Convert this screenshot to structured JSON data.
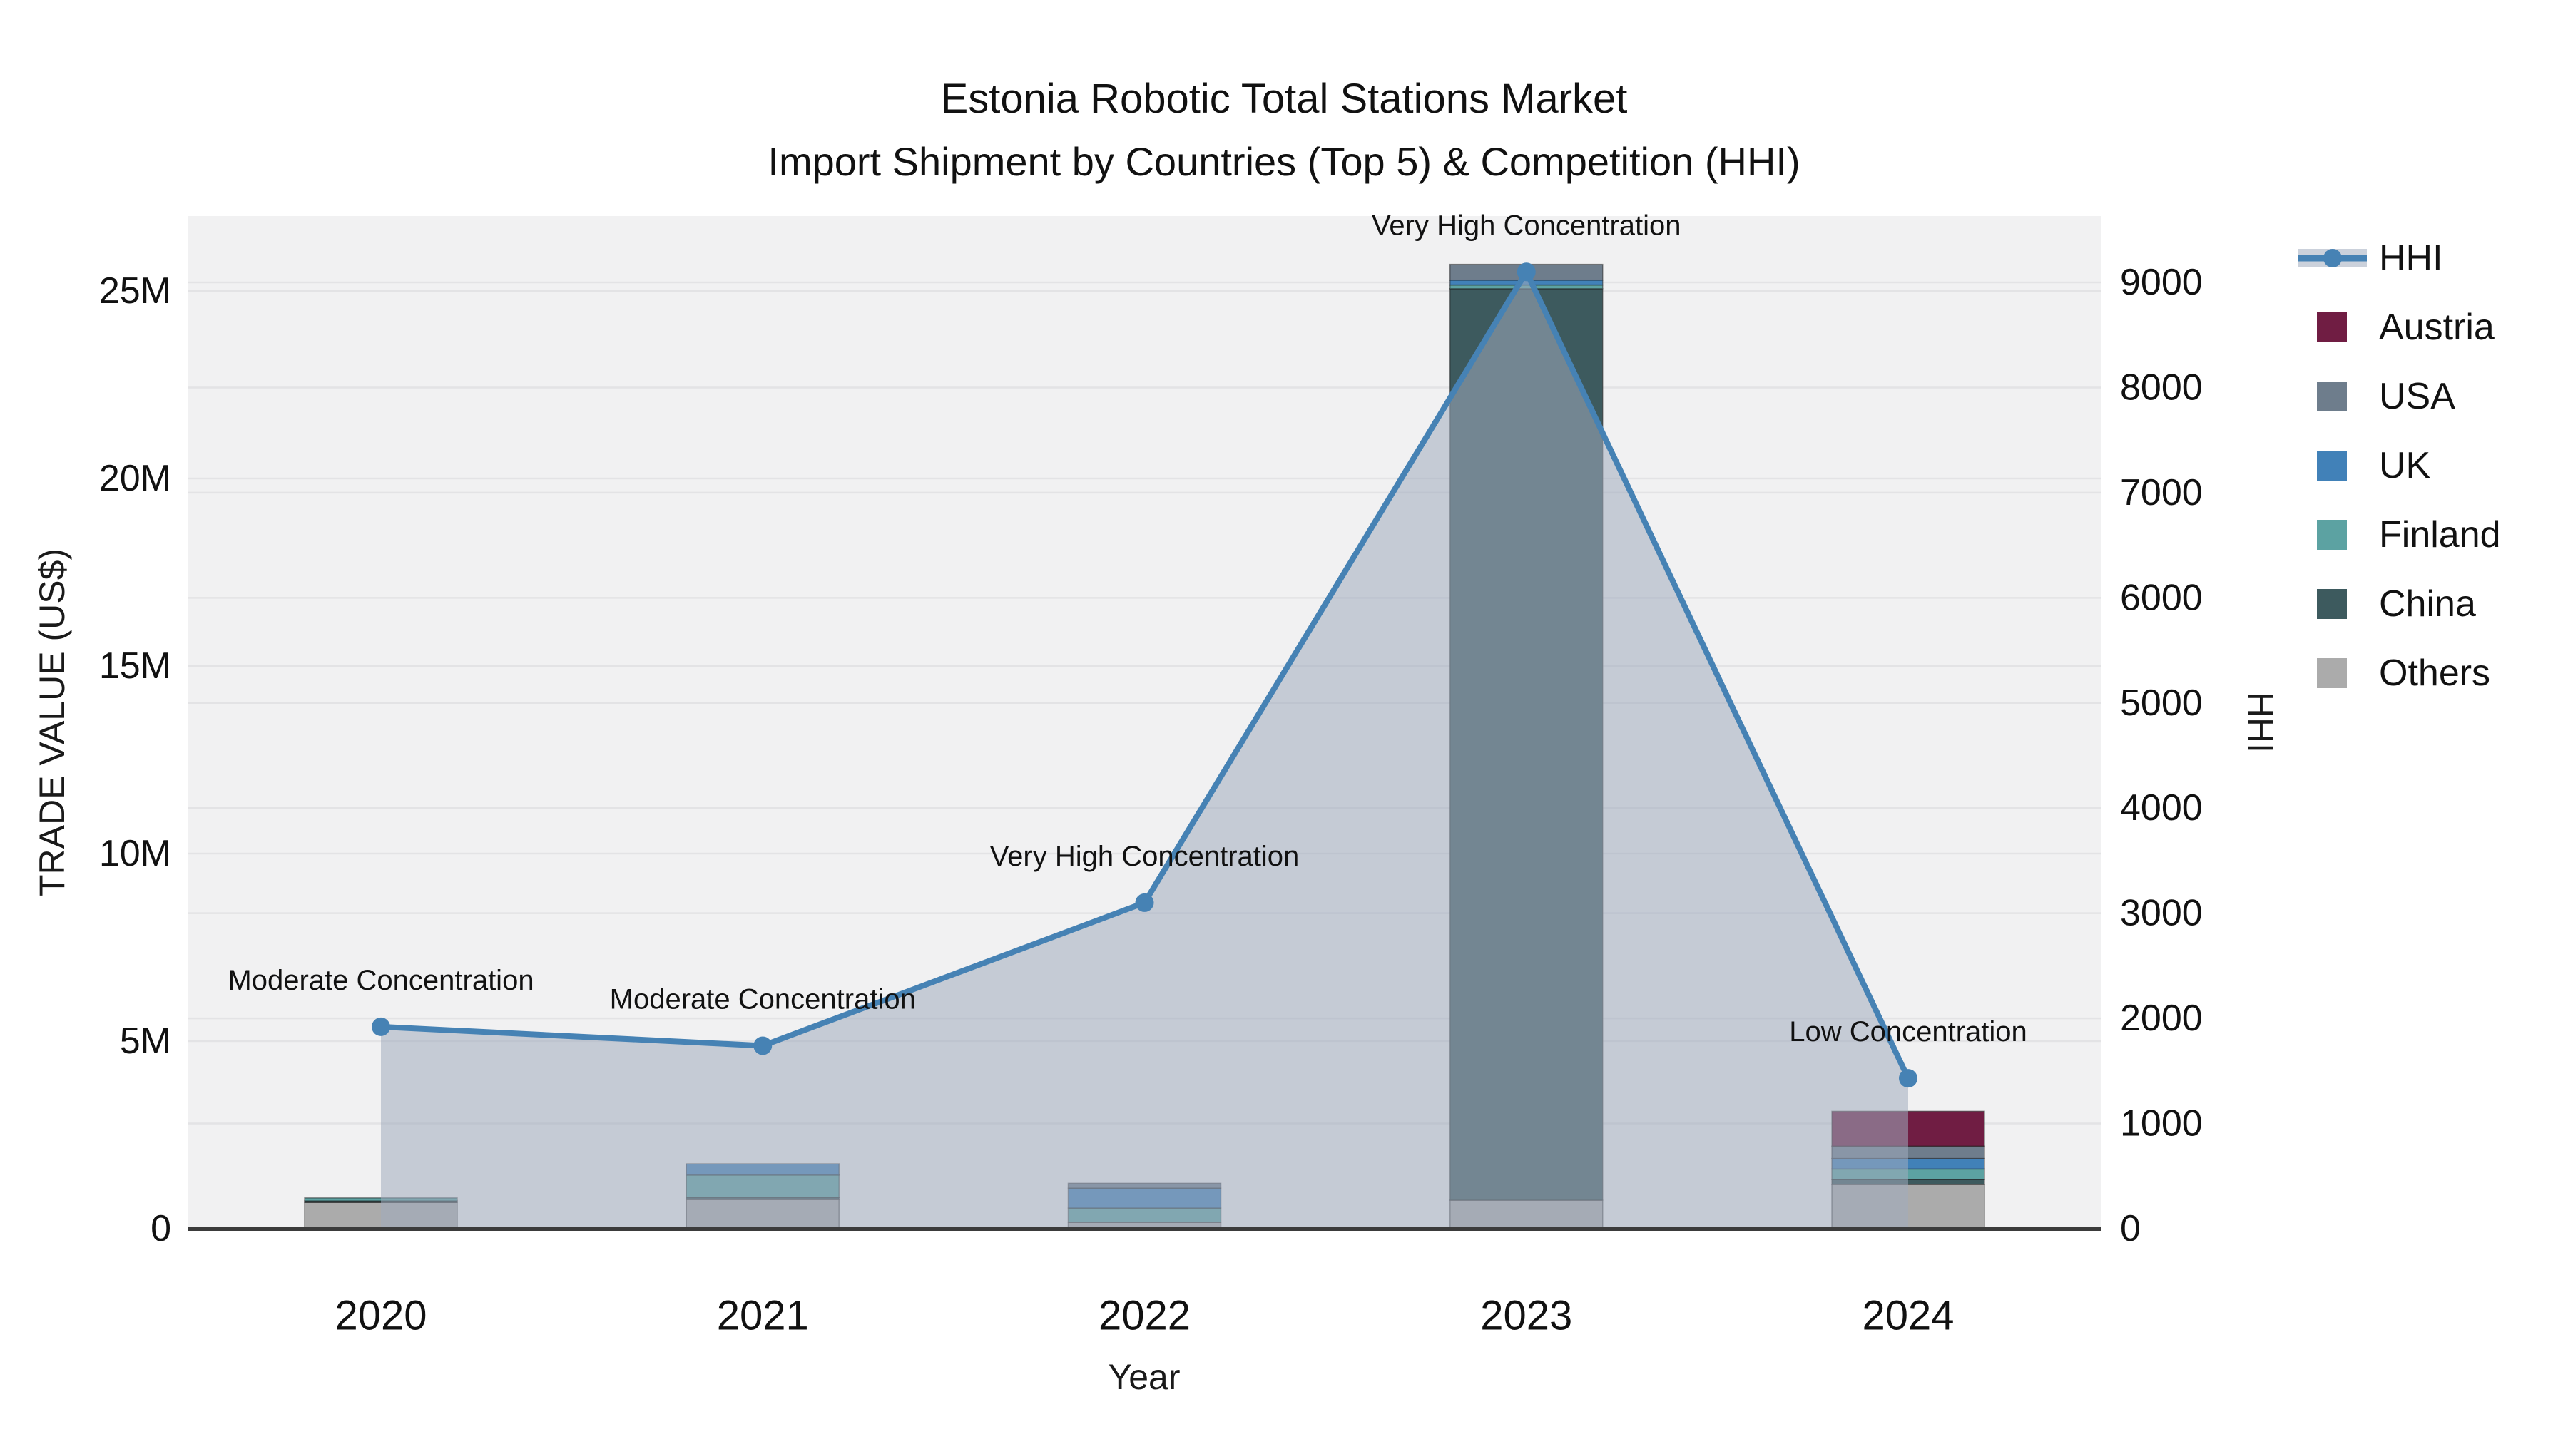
{
  "title": {
    "line1": "Estonia Robotic Total Stations Market",
    "line2": "Import Shipment by Countries (Top 5) & Competition (HHI)"
  },
  "axes": {
    "x": {
      "title": "Year",
      "categories": [
        "2020",
        "2021",
        "2022",
        "2023",
        "2024"
      ]
    },
    "y_left": {
      "title": "TRADE VALUE (US$)",
      "tick_labels": [
        "0",
        "5M",
        "10M",
        "15M",
        "20M",
        "25M"
      ],
      "tick_values": [
        0,
        5,
        10,
        15,
        20,
        25
      ]
    },
    "y_right": {
      "title": "HHI",
      "tick_values": [
        0,
        1000,
        2000,
        3000,
        4000,
        5000,
        6000,
        7000,
        8000,
        9000
      ]
    }
  },
  "legend": [
    {
      "label": "HHI",
      "type": "line",
      "color": "#4682B4"
    },
    {
      "label": "Austria",
      "type": "square",
      "color": "#701D43"
    },
    {
      "label": "USA",
      "type": "square",
      "color": "#6E7D8C"
    },
    {
      "label": "UK",
      "type": "square",
      "color": "#4181B8"
    },
    {
      "label": "Finland",
      "type": "square",
      "color": "#5CA2A2"
    },
    {
      "label": "China",
      "type": "square",
      "color": "#3D5A5E"
    },
    {
      "label": "Others",
      "type": "square",
      "color": "#ABABAB"
    }
  ],
  "chart_data": {
    "type": "bar+line",
    "categories": [
      "2020",
      "2021",
      "2022",
      "2023",
      "2024"
    ],
    "bar_value_unit": "million US$",
    "series": [
      {
        "name": "Others",
        "color": "#ABABAB",
        "values": [
          0.7,
          0.78,
          0.17,
          0.76,
          1.18
        ]
      },
      {
        "name": "China",
        "color": "#3D5A5E",
        "values": [
          0.04,
          0.05,
          0.0,
          24.3,
          0.13
        ]
      },
      {
        "name": "Finland",
        "color": "#5CA2A2",
        "values": [
          0.08,
          0.6,
          0.38,
          0.1,
          0.28
        ]
      },
      {
        "name": "UK",
        "color": "#4181B8",
        "values": [
          0.0,
          0.3,
          0.53,
          0.13,
          0.28
        ]
      },
      {
        "name": "USA",
        "color": "#6E7D8C",
        "values": [
          0.0,
          0.0,
          0.13,
          0.42,
          0.33
        ]
      },
      {
        "name": "Austria",
        "color": "#701D43",
        "values": [
          0.0,
          0.0,
          0.0,
          0.0,
          0.93
        ]
      }
    ],
    "stack_order": "bottom_to_top",
    "bar_totals_musd": [
      0.82,
      1.73,
      1.21,
      25.71,
      3.13
    ],
    "line_series": {
      "name": "HHI",
      "color": "#4682B4",
      "values": [
        1920,
        1740,
        3100,
        9100,
        1430
      ],
      "area_fill": "rgba(161,172,189,0.55)"
    },
    "annotations": [
      {
        "category": "2020",
        "text": "Moderate Concentration"
      },
      {
        "category": "2021",
        "text": "Moderate Concentration"
      },
      {
        "category": "2022",
        "text": "Very High Concentration"
      },
      {
        "category": "2023",
        "text": "Very High Concentration"
      },
      {
        "category": "2024",
        "text": "Low Concentration"
      }
    ],
    "xlabel": "Year",
    "ylabel_left": "TRADE VALUE (US$)",
    "ylabel_right": "HHI",
    "ylim_left_musd": [
      0,
      27
    ],
    "ylim_right_hhi": [
      0,
      9640
    ],
    "grid": true,
    "legend_position": "outside-top-right",
    "plot_background": "#F1F1F2",
    "gridline_color": "#E3E3E5"
  }
}
